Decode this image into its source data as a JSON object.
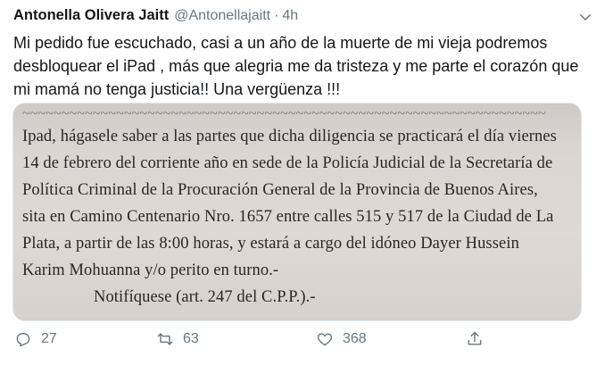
{
  "tweet": {
    "author_name": "Antonella Olivera Jaitt",
    "author_handle": "@Antonellajaitt",
    "separator": "·",
    "time": "4h",
    "text": "Mi pedido fue escuchado, casi a un año de la muerte de mi vieja podremos desbloquear el iPad , más que alegria me da tristeza y me parte el corazón que mi mamá no tenga justicia!! Una vergüenza !!!"
  },
  "document": {
    "lines": [
      "Ipad, hágasele saber a las partes que dicha diligencia se practicará el día viernes",
      "14 de febrero del corriente año en sede de la Policía Judicial de la Secretaría de",
      "Política Criminal de la Procuración General de la Provincia de Buenos Aires,",
      "sita en Camino Centenario Nro. 1657 entre calles 515 y 517 de la Ciudad de La",
      "Plata, a partir de las 8:00 horas, y estará a cargo del idóneo Dayer Hussein",
      "Karim Mohuanna y/o perito en turno.-",
      "Notifíquese (art. 247 del C.P.P.).-"
    ]
  },
  "actions": {
    "reply_count": "27",
    "retweet_count": "63",
    "like_count": "368"
  },
  "icons": {
    "caret": "chevron-down-icon",
    "reply": "reply-icon",
    "retweet": "retweet-icon",
    "like": "heart-icon",
    "share": "share-icon"
  },
  "colors": {
    "text": "#14171a",
    "secondary": "#657786",
    "border": "#e1e8ed"
  }
}
